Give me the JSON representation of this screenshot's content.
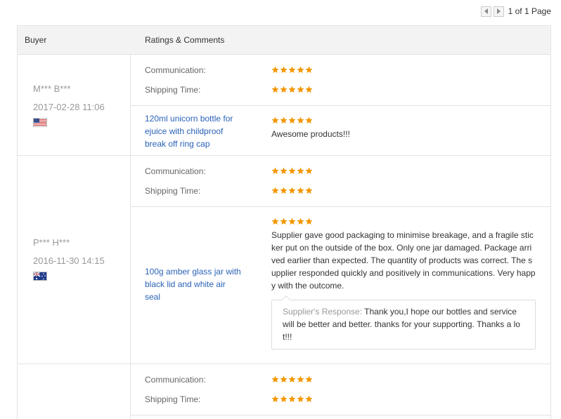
{
  "pager": {
    "prev_icon": "caret-left-icon",
    "next_icon": "caret-right-icon",
    "text": "1 of 1 Page"
  },
  "header": {
    "buyer": "Buyer",
    "ratings": "Ratings & Comments"
  },
  "labels": {
    "communication": "Communication:",
    "shipping": "Shipping Time:",
    "response_label": "Supplier's Response:"
  },
  "colors": {
    "star": "#f39700",
    "link": "#2b63b8",
    "muted": "#999999"
  },
  "reviews": [
    {
      "buyer": "M*** B***",
      "date": "2017-02-28 11:06",
      "flag": "us-flag-icon",
      "communication_stars": 5,
      "shipping_stars": 5,
      "product": "120ml unicorn bottle for ejuice with childproof break off ring cap",
      "feedback_stars": 5,
      "feedback": "Awesome products!!!"
    },
    {
      "buyer": "P*** H***",
      "date": "2016-11-30 14:15",
      "flag": "au-flag-icon",
      "communication_stars": 5,
      "shipping_stars": 5,
      "product": "100g amber glass jar with black lid and white air seal",
      "feedback_stars": 5,
      "feedback": "Supplier gave good packaging to minimise breakage, and a fragile sticker put on the outside of the box. Only one jar damaged. Package arrived earlier than expected. The quantity of products was correct. The supplier responded quickly and positively in communications. Very happy with the outcome.",
      "response": "Thank you,I hope our bottles and service will be better and better. thanks for your supporting. Thanks a lot!!!"
    },
    {
      "communication_stars": 5,
      "shipping_stars": 5
    }
  ]
}
